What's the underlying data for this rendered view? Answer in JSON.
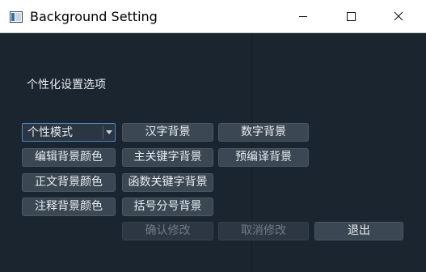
{
  "window": {
    "title": "Background Setting",
    "icon": "window-app-icon",
    "controls": {
      "minimize": "minimize-icon",
      "maximize": "maximize-icon",
      "close": "close-icon"
    }
  },
  "content": {
    "section_label": "个性化设置选项",
    "mode_select": {
      "selected": "个性模式"
    },
    "buttons": {
      "hanzi_bg": "汉字背景",
      "number_bg": "数字背景",
      "editor_bg_color": "编辑背景颜色",
      "keyword_bg": "主关键字背景",
      "preprocessor_bg": "预编译背景",
      "body_bg_color": "正文背景颜色",
      "function_keyword_bg": "函数关键字背景",
      "comment_bg_color": "注释背景颜色",
      "bracket_semicolon_bg": "括号分号背景",
      "confirm": "确认修改",
      "cancel": "取消修改",
      "exit": "退出"
    }
  },
  "colors": {
    "background": "#1b2530",
    "button": "#3b4854",
    "button_disabled_text": "#6f7a85",
    "combo_focus_border": "#4f86c6",
    "titlebar": "#ffffff"
  }
}
